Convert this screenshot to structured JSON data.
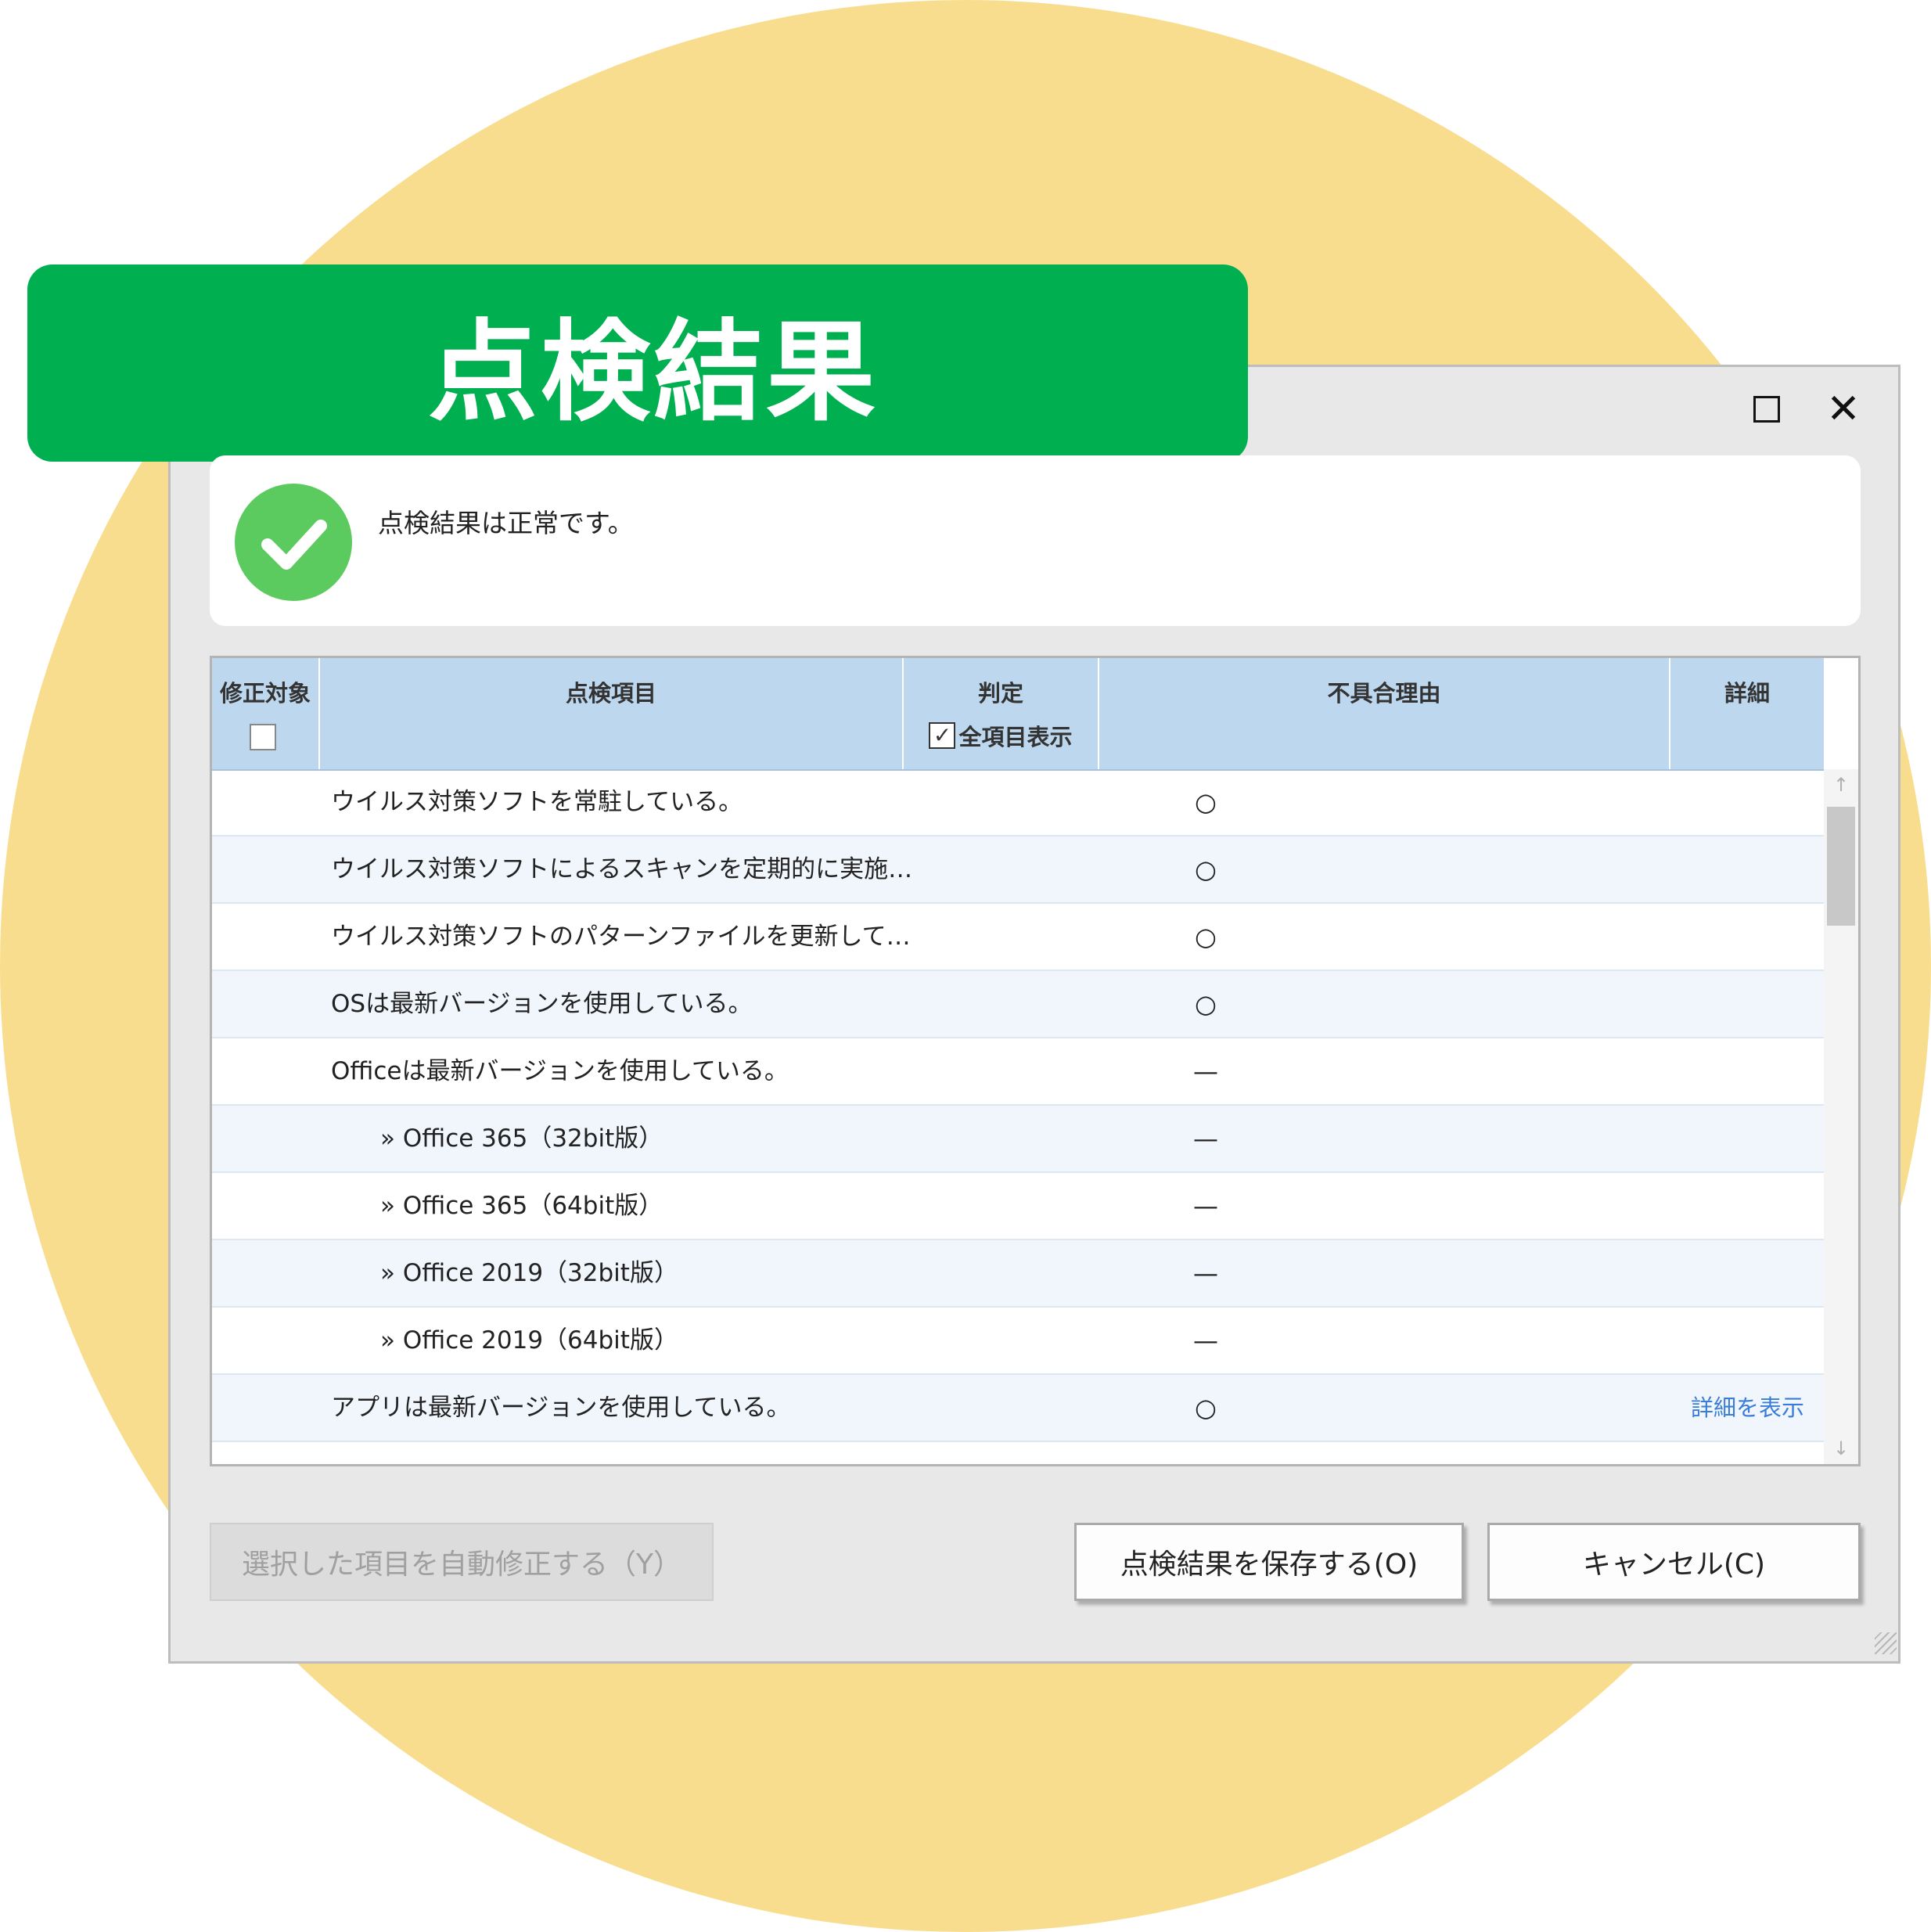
{
  "banner": {
    "title": "点検結果"
  },
  "window": {
    "maximize_icon": "maximize-icon",
    "close_glyph": "✕"
  },
  "status": {
    "message": "点検結果は正常です。",
    "icon": "check-circle-icon",
    "icon_color": "#5ccb5f"
  },
  "table": {
    "headers": {
      "fix_target": "修正対象",
      "item": "点検項目",
      "judgement": "判定",
      "show_all": "全項目表示",
      "show_all_checked": true,
      "reason": "不具合理由",
      "detail": "詳細"
    },
    "rows": [
      {
        "item": "ウイルス対策ソフトを常駐している。",
        "judgement": "○",
        "detail": ""
      },
      {
        "item": "ウイルス対策ソフトによるスキャンを定期的に実施…",
        "judgement": "○",
        "detail": ""
      },
      {
        "item": "ウイルス対策ソフトのパターンファイルを更新して…",
        "judgement": "○",
        "detail": ""
      },
      {
        "item": "OSは最新バージョンを使用している。",
        "judgement": "○",
        "detail": ""
      },
      {
        "item": "Officeは最新バージョンを使用している。",
        "judgement": "—",
        "detail": ""
      },
      {
        "item": "» Office 365（32bit版）",
        "judgement": "—",
        "detail": ""
      },
      {
        "item": "» Office 365（64bit版）",
        "judgement": "—",
        "detail": ""
      },
      {
        "item": "» Office 2019（32bit版）",
        "judgement": "—",
        "detail": ""
      },
      {
        "item": "» Office 2019（64bit版）",
        "judgement": "—",
        "detail": ""
      },
      {
        "item": "アプリは最新バージョンを使用している。",
        "judgement": "○",
        "detail": "詳細を表示"
      }
    ]
  },
  "buttons": {
    "auto_fix": "選択した項目を自動修正する（Y）",
    "save": "点検結果を保存する(O)",
    "cancel": "キャンセル(C)"
  },
  "colors": {
    "banner": "#00b050",
    "background_circle": "#f9dd8f",
    "header": "#bdd7ee",
    "link": "#3a7dd8"
  }
}
